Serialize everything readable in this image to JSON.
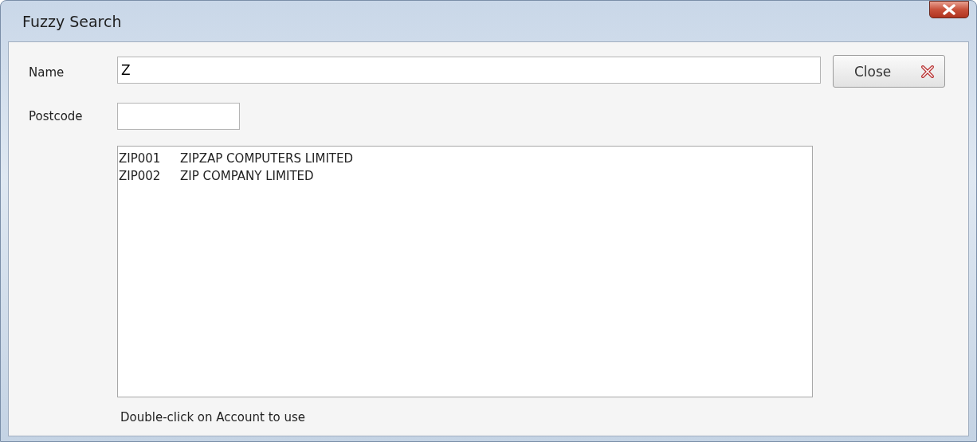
{
  "window": {
    "title": "Fuzzy Search"
  },
  "name_field": {
    "label": "Name",
    "value": "Z"
  },
  "postcode_field": {
    "label": "Postcode"
  },
  "close_button": {
    "label": "Close"
  },
  "accounts": [
    {
      "code": "ZIP001",
      "name": "ZIPZAP COMPUTERS LIMITED"
    },
    {
      "code": "ZIP002",
      "name": "ZIP COMPANY LIMITED"
    }
  ],
  "hint": "Double-click on Account to use"
}
